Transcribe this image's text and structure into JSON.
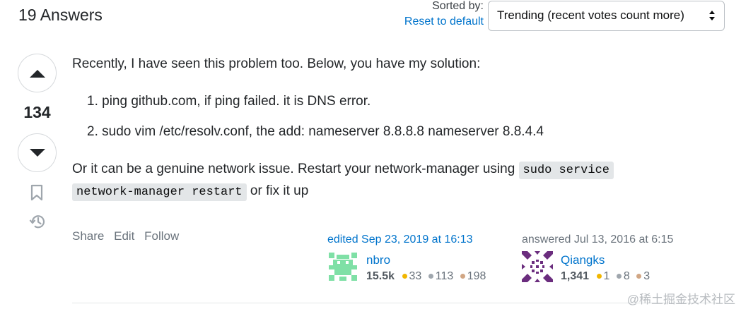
{
  "header": {
    "answers_count": "19 Answers",
    "sorted_by_label": "Sorted by:",
    "reset_link": "Reset to default",
    "sort_value": "Trending (recent votes count more)"
  },
  "votes": {
    "count": "134"
  },
  "post": {
    "para1": "Recently, I have seen this problem too. Below, you have my solution:",
    "list": [
      "1. ping github.com, if ping failed. it is DNS error.",
      "2. sudo vim /etc/resolv.conf, the add: nameserver 8.8.8.8 nameserver 8.8.4.4"
    ],
    "para2_text": "Or it can be a genuine network issue. Restart your network-manager using",
    "code_part1": "sudo service",
    "code_part2": "network-manager restart",
    "para2_tail": "or fix it up"
  },
  "menu": {
    "share": "Share",
    "edit": "Edit",
    "follow": "Follow"
  },
  "editor": {
    "label": "edited Sep 23, 2019 at 16:13",
    "name": "nbro",
    "reputation": "15.5k",
    "gold": "33",
    "silver": "113",
    "bronze": "198"
  },
  "author": {
    "label": "answered Jul 13, 2016 at 6:15",
    "name": "Qiangks",
    "reputation": "1,341",
    "gold": "1",
    "silver": "8",
    "bronze": "3"
  },
  "watermark": "@稀土掘金技术社区",
  "colors": {
    "link": "#0074cc",
    "gold": "#f1b600",
    "silver": "#9fa6ad",
    "bronze": "#d1a684",
    "editor_avatar": "#7fe0a6",
    "author_avatar": "#6b2d7e"
  }
}
